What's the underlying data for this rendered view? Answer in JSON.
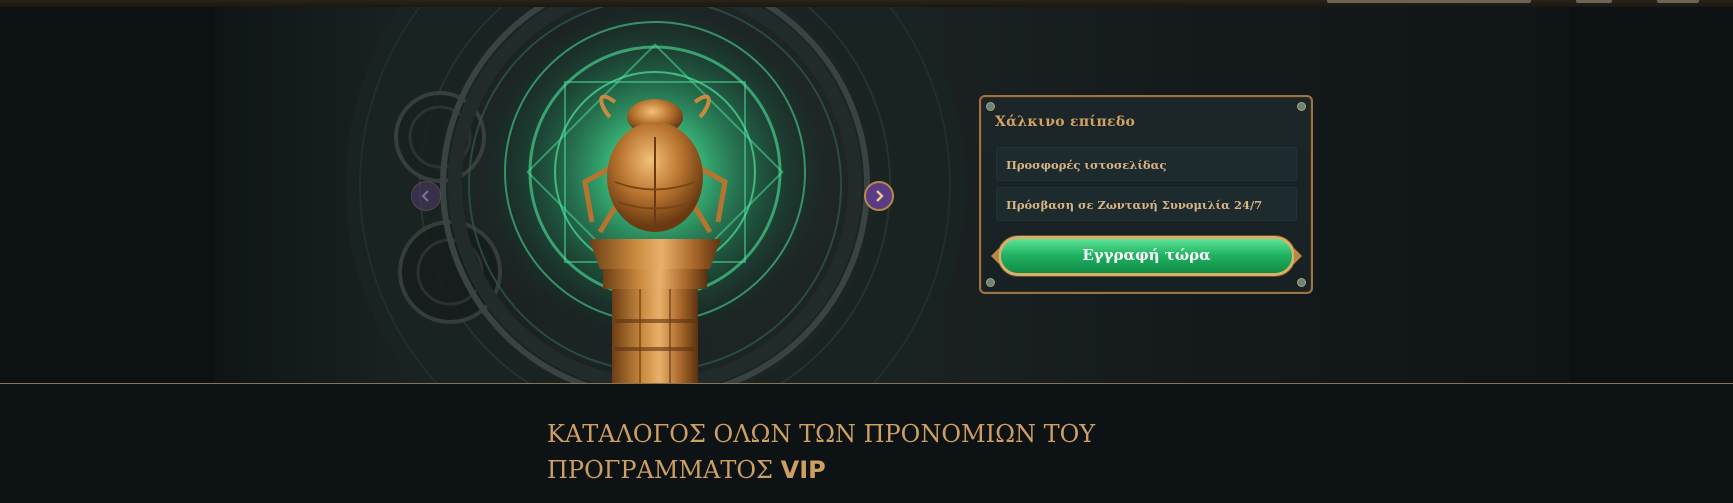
{
  "hero": {
    "card": {
      "level_title": "Χάλκινο επίπεδο",
      "perks": [
        "Προσφορές ιστοσελίδας",
        "Πρόσβαση σε Ζωντανή Συνομιλία 24/7"
      ],
      "cta_label": "Εγγραφή τώρα"
    },
    "icons": {
      "prev": "chevron-left-icon",
      "next": "chevron-right-icon",
      "artwork": "scarab-trophy"
    }
  },
  "section": {
    "heading_line1": "ΚΑΤΑΛΟΓΟΣ ΟΛΩΝ ΤΩΝ ΠΡΟΝΟΜΙΩΝ ΤΟΥ",
    "heading_line2_prefix": "ΠΡΟΓΡΑΜΜΑΤΟΣ ",
    "heading_line2_bold": "VIP"
  },
  "colors": {
    "accent_gold": "#cf9f62",
    "cta_green": "#22b563",
    "background": "#0d1214",
    "glow_green": "#3cd88a"
  }
}
